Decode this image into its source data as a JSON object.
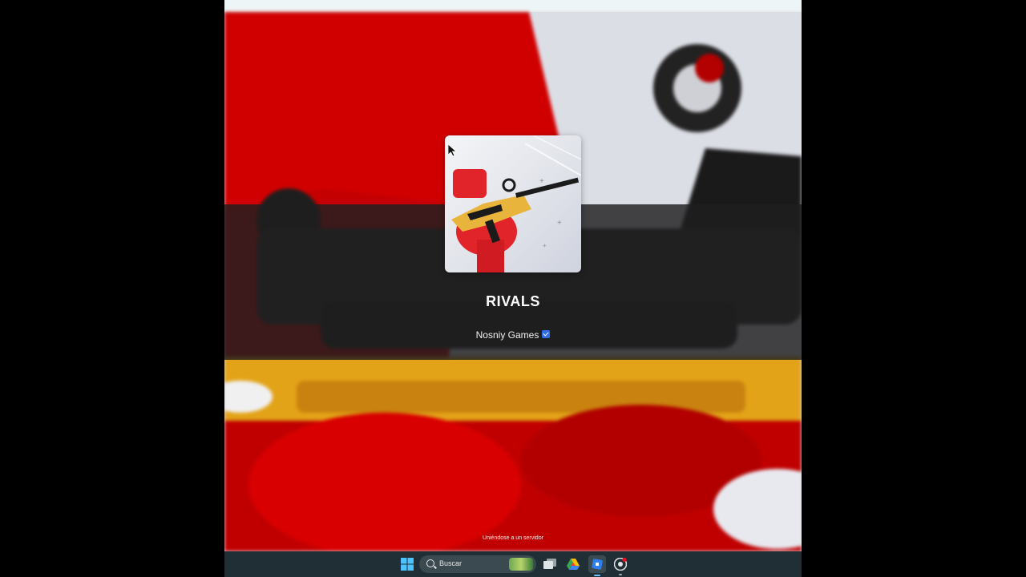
{
  "game": {
    "title": "RIVALS",
    "creator": "Nosniy Games"
  },
  "status_text": "Uniéndose a un servidor",
  "taskbar": {
    "search_label": "Buscar",
    "icons": [
      "windows-start-icon",
      "search-icon",
      "task-view-icon",
      "google-drive-icon",
      "roblox-icon",
      "chrome-icon"
    ]
  },
  "colors": {
    "accent_red": "#d40000",
    "gun_gold": "#e0a515",
    "band": "#1e1e20",
    "taskbar": "#1f2f35",
    "verified_blue": "#2f6ee8"
  }
}
